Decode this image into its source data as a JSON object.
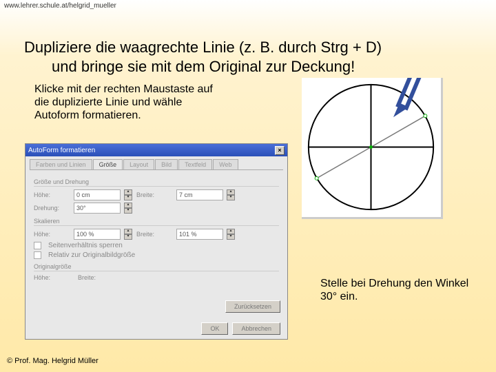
{
  "url": "www.lehrer.schule.at/helgrid_mueller",
  "title": {
    "line1": "Dupliziere die waagrechte Linie  (z. B. durch Strg + D)",
    "line2": "und bringe sie mit dem Original zur Deckung!"
  },
  "instruction": "Klicke mit der rechten Maustaste auf die duplizierte Linie und wähle Autoform formatieren.",
  "note": "Stelle bei Drehung den Winkel 30° ein.",
  "footer": "© Prof. Mag. Helgrid Müller",
  "dialog": {
    "title": "AutoForm formatieren",
    "close": "×",
    "tabs": [
      "Farben und Linien",
      "Größe",
      "Layout",
      "Bild",
      "Textfeld",
      "Web"
    ],
    "groups": {
      "size": "Größe und Drehung",
      "scale": "Skalieren",
      "orig": "Originalgröße"
    },
    "labels": {
      "hoehe": "Höhe:",
      "breite": "Breite:",
      "drehung": "Drehung:",
      "lock": "Seitenverhältnis sperren",
      "relative": "Relativ zur Originalbildgröße"
    },
    "values": {
      "hoehe": "0 cm",
      "breite": "7 cm",
      "drehung": "30°",
      "hoehe_pct": "100 %",
      "breite_pct": "101 %",
      "orig_h": "",
      "orig_w": ""
    },
    "buttons": {
      "reset": "Zurücksetzen",
      "ok": "OK",
      "cancel": "Abbrechen"
    }
  }
}
